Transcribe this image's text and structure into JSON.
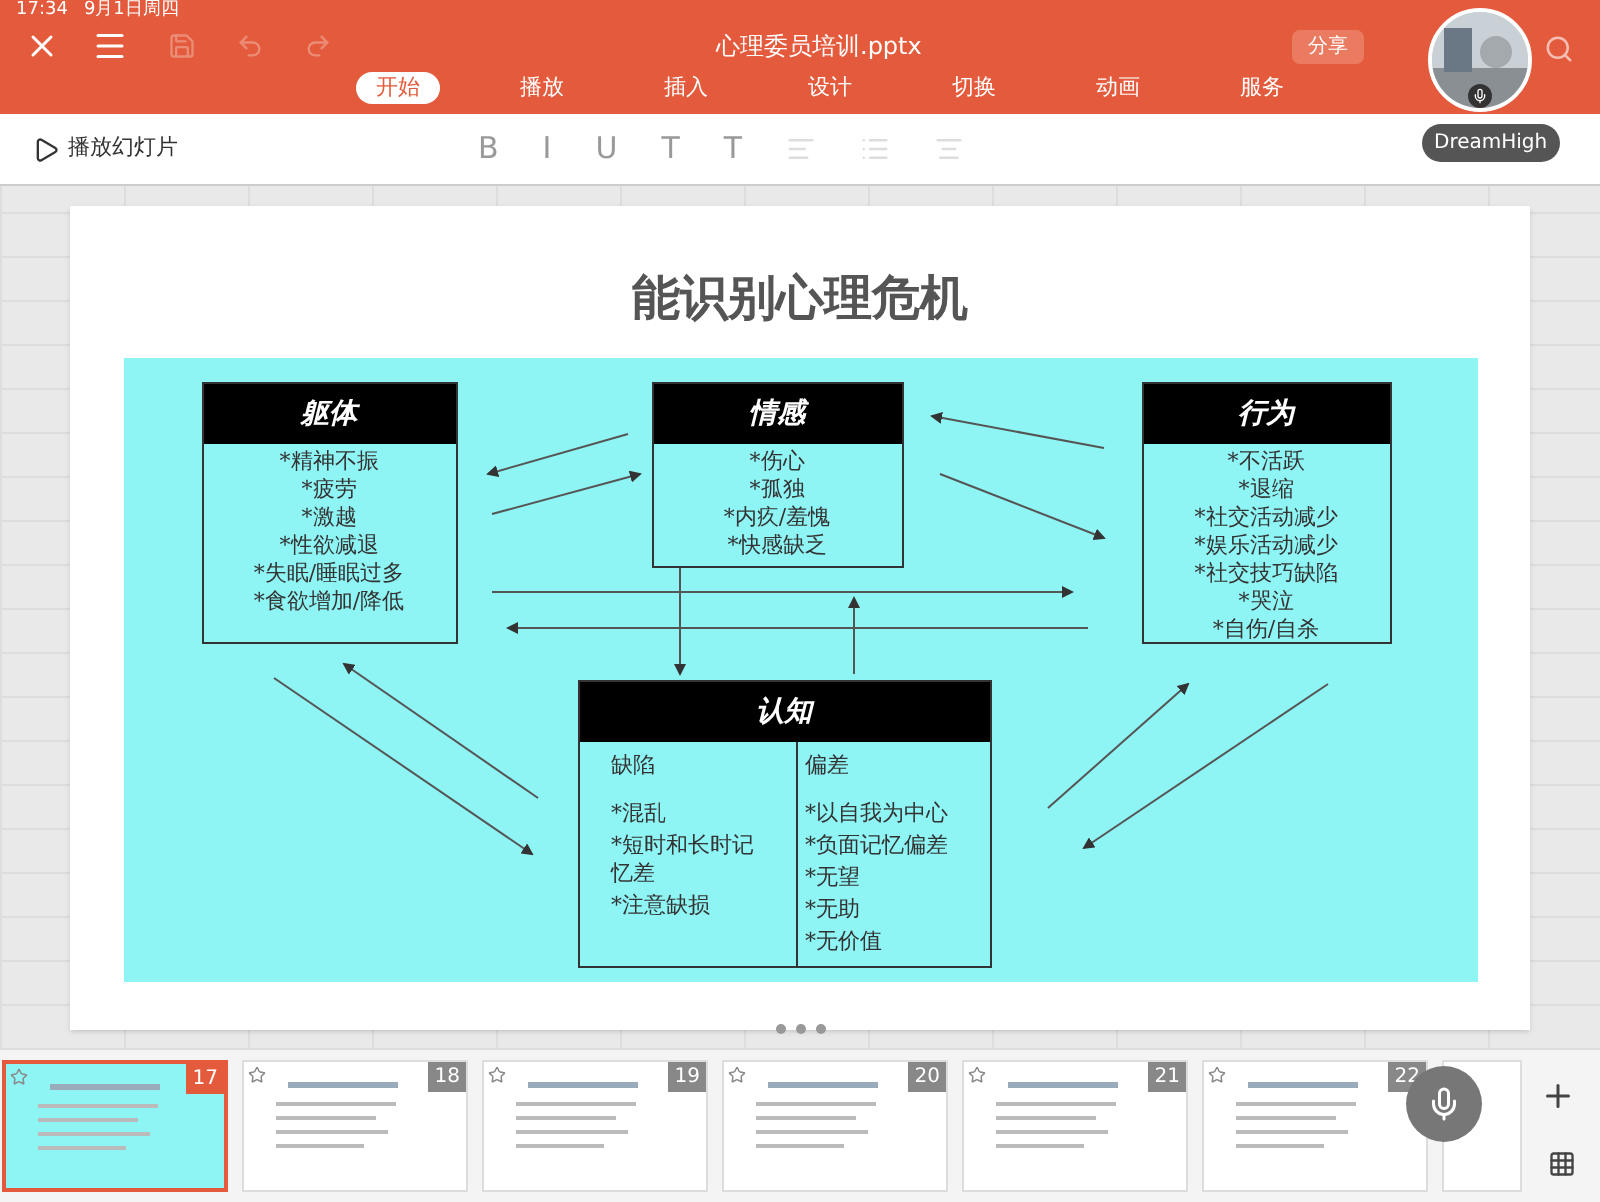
{
  "status_bar": {
    "time": "17:34",
    "date": "9月1日周四"
  },
  "window": {
    "title": "心理委员培训.pptx",
    "share": "分享"
  },
  "tabs": [
    {
      "label": "开始",
      "selected": true
    },
    {
      "label": "播放",
      "selected": false
    },
    {
      "label": "插入",
      "selected": false
    },
    {
      "label": "设计",
      "selected": false
    },
    {
      "label": "切换",
      "selected": false
    },
    {
      "label": "动画",
      "selected": false
    },
    {
      "label": "服务",
      "selected": false
    }
  ],
  "toolbar": {
    "play": "播放幻灯片",
    "format_buttons": [
      {
        "label": "B",
        "disabled": true
      },
      {
        "label": "I",
        "disabled": true
      },
      {
        "label": "U",
        "disabled": true
      },
      {
        "label": "T",
        "disabled": true
      },
      {
        "label": "T",
        "disabled": true
      }
    ]
  },
  "presenter": {
    "name": "DreamHigh"
  },
  "slide": {
    "title": "能识别心理危机",
    "boxes": [
      {
        "kind": "list",
        "heading": "躯体",
        "items": [
          "*精神不振",
          "*疲劳",
          "*激越",
          "*性欲减退",
          "*失眠/睡眠过多",
          "*食欲增加/降低"
        ]
      },
      {
        "kind": "list",
        "heading": "情感",
        "items": [
          "*伤心",
          "*孤独",
          "*内疚/羞愧",
          "*快感缺乏"
        ]
      },
      {
        "kind": "list",
        "heading": "行为",
        "items": [
          "*不活跃",
          "*退缩",
          "*社交活动减少",
          "*娱乐活动减少",
          "*社交技巧缺陷",
          "*哭泣",
          "*自伤/自杀"
        ]
      },
      {
        "kind": "columns",
        "heading": "认知",
        "columns": [
          {
            "heading": "缺陷",
            "items": [
              "*混乱",
              "*短时和长时记忆差",
              "*注意缺损"
            ]
          },
          {
            "heading": "偏差",
            "items": [
              "*以自我为中心",
              "*负面记忆偏差",
              "*无望",
              "*无助",
              "*无价值"
            ]
          }
        ]
      }
    ]
  },
  "thumbnails": [
    {
      "number": "17",
      "selected": true
    },
    {
      "number": "18",
      "selected": false
    },
    {
      "number": "19",
      "selected": false
    },
    {
      "number": "20",
      "selected": false
    },
    {
      "number": "21",
      "selected": false
    },
    {
      "number": "22",
      "selected": false
    }
  ]
}
